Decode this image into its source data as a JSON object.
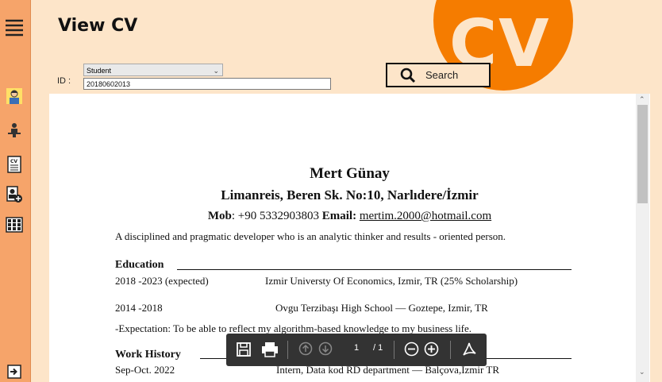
{
  "window": {
    "title": "View CV"
  },
  "header": {
    "logo_text": "CV"
  },
  "filter": {
    "role_selected": "Student",
    "id_label": "ID :",
    "id_value": "20180602013"
  },
  "search": {
    "label": "Search"
  },
  "sidebar": {
    "items": [
      {
        "icon": "menu-icon"
      },
      {
        "icon": "student-icon"
      },
      {
        "icon": "teacher-icon"
      },
      {
        "icon": "cv-document-icon"
      },
      {
        "icon": "add-person-icon"
      },
      {
        "icon": "grid-icon"
      },
      {
        "icon": "logout-icon"
      }
    ]
  },
  "cv": {
    "name": "Mert Günay",
    "address": "Limanreis, Beren Sk. No:10,  Narlıdere/İzmir",
    "mob_label": "Mob",
    "mob_value": ": +90 5332903803",
    "email_label": "Email:",
    "email_value": "mertim.2000@hotmail.com",
    "summary": "A disciplined and pragmatic developer who is an analytic thinker and results - oriented person.",
    "education_title": "Education",
    "education": [
      {
        "date": "2018 -2023 (expected)",
        "detail": "Izmir Universty Of Economics, Izmir, TR (25% Scholarship)"
      },
      {
        "date": "2014 -2018",
        "detail": "Ovgu Terzibaşı High School — Goztepe, Izmir, TR"
      }
    ],
    "expectation": "-Expectation: To be able to reflect my algorithm-based knowledge to my business life.",
    "work_title": "Work History",
    "work": [
      {
        "date": "Sep-Oct. 2022",
        "detail": "Intern, Data kod RD department — Balçova,İzmir TR"
      }
    ]
  },
  "pdf_toolbar": {
    "page_current": "1",
    "page_total": "/ 1"
  },
  "colors": {
    "sidebar": "#f6a46a",
    "header_bg": "#fde5c9",
    "accent": "#f57c00",
    "toolbar": "#333333"
  }
}
